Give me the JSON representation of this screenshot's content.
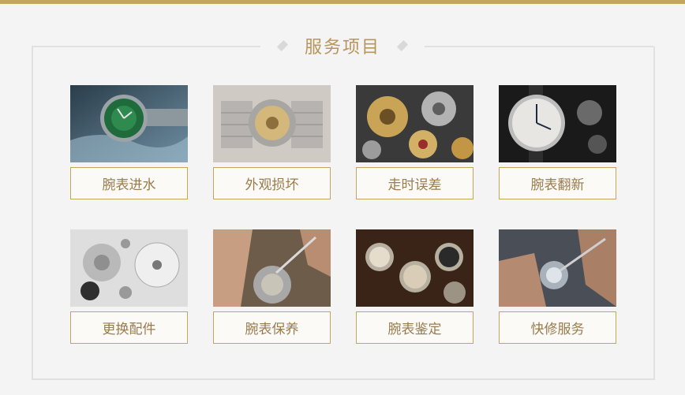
{
  "section": {
    "title": "服务项目"
  },
  "services": [
    {
      "label": "腕表进水",
      "image": "green-dial-watch-in-water-photo"
    },
    {
      "label": "外观损坏",
      "image": "watch-caseback-bracelet-photo"
    },
    {
      "label": "走时误差",
      "image": "watch-movement-gears-photo"
    },
    {
      "label": "腕表翻新",
      "image": "white-dial-watch-photo"
    },
    {
      "label": "更换配件",
      "image": "watch-parts-disassembled-photo"
    },
    {
      "label": "腕表保养",
      "image": "watch-maintenance-tweezers-photo"
    },
    {
      "label": "腕表鉴定",
      "image": "vintage-chronographs-photo"
    },
    {
      "label": "快修服务",
      "image": "watch-repair-hands-photo"
    }
  ],
  "colors": {
    "accent": "#c4a55e",
    "title": "#b8955a",
    "label_text": "#9a7c4c"
  }
}
